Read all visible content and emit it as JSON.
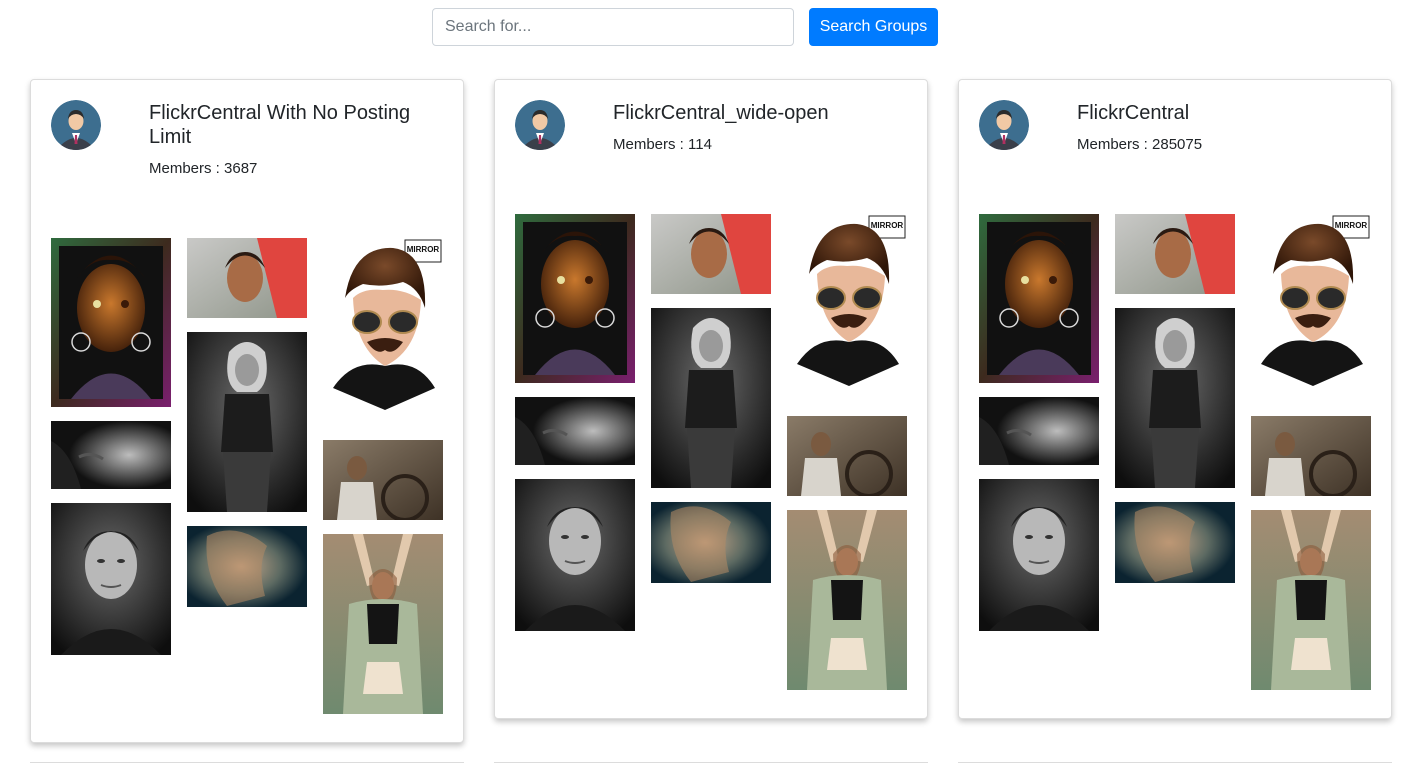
{
  "search": {
    "placeholder": "Search for...",
    "value": "",
    "button_label": "Search Groups"
  },
  "groups": [
    {
      "title": "FlickrCentral With No Posting Limit",
      "members_label": "Members",
      "members_count": "3687",
      "avatar_icon": "user-avatar-icon"
    },
    {
      "title": "FlickrCentral_wide-open",
      "members_label": "Members",
      "members_count": "114",
      "avatar_icon": "user-avatar-icon"
    },
    {
      "title": "FlickrCentral",
      "members_label": "Members",
      "members_count": "285075",
      "avatar_icon": "user-avatar-icon"
    }
  ],
  "photo_thumbnails": [
    "colorful-art-portrait",
    "woman-red-scarf-portrait",
    "woman-black-white-portrait",
    "mirror-glasses-illustration",
    "smoke-black-white",
    "street-vendor-cart",
    "man-black-white-portrait",
    "blurred-woman-portrait",
    "woman-knit-cardigan"
  ],
  "mirror_logo_text": "MIRROR",
  "colors": {
    "primary": "#007bff",
    "card_border": "#dcdcdc",
    "text": "#212529",
    "muted_text": "#6c757d",
    "avatar_background": "#3d6e8f"
  }
}
